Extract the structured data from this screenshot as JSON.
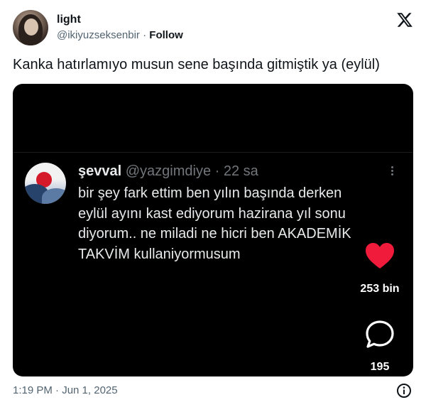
{
  "user": {
    "name": "light",
    "handle": "@ikiyuzseksenbir",
    "separator": "·",
    "follow_label": "Follow"
  },
  "tweet": {
    "text": "Kanka hatırlamıyo musun sene başında gitmiştik ya (eylül)",
    "timestamp": "1:19 PM · Jun 1, 2025"
  },
  "quoted": {
    "name": "şevval",
    "handle": "@yazgimdiye",
    "meta": "· 22 sa",
    "lines": [
      "bir şey fark ettim ben yılın başında derken",
      "eylül ayını kast ediyorum hazirana yıl sonu",
      "diyorum.. ne miladi ne hicri ben AKADEMİK",
      "TAKVİM kullaniyormusum"
    ],
    "likes": "253 bin",
    "comments": "195"
  },
  "icons": {
    "brand": "x-logo-icon",
    "like": "heart-icon",
    "comment": "speech-bubble-icon",
    "info": "info-icon",
    "more": "more-vertical-icon"
  },
  "colors": {
    "like_red": "#f01a3a",
    "text_dark": "#0f1419",
    "text_muted": "#536471",
    "media_bg": "#000000"
  }
}
